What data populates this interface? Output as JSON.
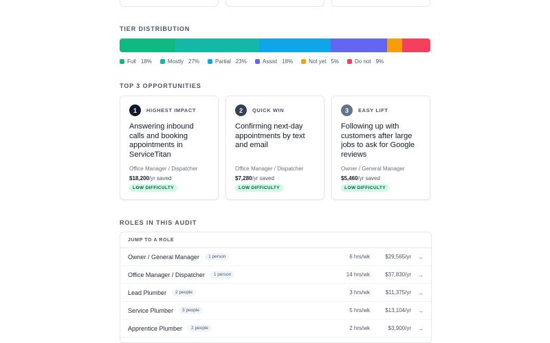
{
  "tier": {
    "title": "TIER DISTRIBUTION",
    "segments": [
      {
        "name": "Full",
        "pct": "18%",
        "value": 18,
        "color": "#10b981"
      },
      {
        "name": "Mostly",
        "pct": "27%",
        "value": 27,
        "color": "#14b8a6"
      },
      {
        "name": "Partial",
        "pct": "23%",
        "value": 23,
        "color": "#0ea5e9"
      },
      {
        "name": "Assist",
        "pct": "18%",
        "value": 18,
        "color": "#6366f1"
      },
      {
        "name": "Not yet",
        "pct": "5%",
        "value": 5,
        "color": "#f59e0b"
      },
      {
        "name": "Do not",
        "pct": "9%",
        "value": 9,
        "color": "#f43f5e"
      }
    ]
  },
  "opportunities": {
    "title": "TOP 3 OPPORTUNITIES",
    "items": [
      {
        "num": "1",
        "tag": "HIGHEST IMPACT",
        "color": "#111827",
        "title": "Answering inbound calls and booking appointments in ServiceTitan",
        "role": "Office Manager / Dispatcher",
        "amount": "$18,200",
        "suffix": "/yr saved",
        "badge": "LOW DIFFICULTY"
      },
      {
        "num": "2",
        "tag": "QUICK WIN",
        "color": "#334155",
        "title": "Confirming next-day appointments by text and email",
        "role": "Office Manager / Dispatcher",
        "amount": "$7,280",
        "suffix": "/yr saved",
        "badge": "LOW DIFFICULTY"
      },
      {
        "num": "3",
        "tag": "EASY LIFT",
        "color": "#64748b",
        "title": "Following up with customers after large jobs to ask for Google reviews",
        "role": "Owner / General Manager",
        "amount": "$5,460",
        "suffix": "/yr saved",
        "badge": "LOW DIFFICULTY"
      }
    ]
  },
  "roles": {
    "title": "ROLES IN THIS AUDIT",
    "jump_label": "JUMP TO A ROLE",
    "rows": [
      {
        "name": "Owner / General Manager",
        "count": "1 person",
        "hrs": "6 hrs/wk",
        "cost": "$29,565/yr"
      },
      {
        "name": "Office Manager / Dispatcher",
        "count": "1 person",
        "hrs": "14 hrs/wk",
        "cost": "$37,830/yr"
      },
      {
        "name": "Lead Plumber",
        "count": "2 people",
        "hrs": "3 hrs/wk",
        "cost": "$11,375/yr"
      },
      {
        "name": "Service Plumber",
        "count": "3 people",
        "hrs": "5 hrs/wk",
        "cost": "$13,104/yr"
      },
      {
        "name": "Apprentice Plumber",
        "count": "2 people",
        "hrs": "2 hrs/wk",
        "cost": "$3,900/yr"
      }
    ]
  }
}
